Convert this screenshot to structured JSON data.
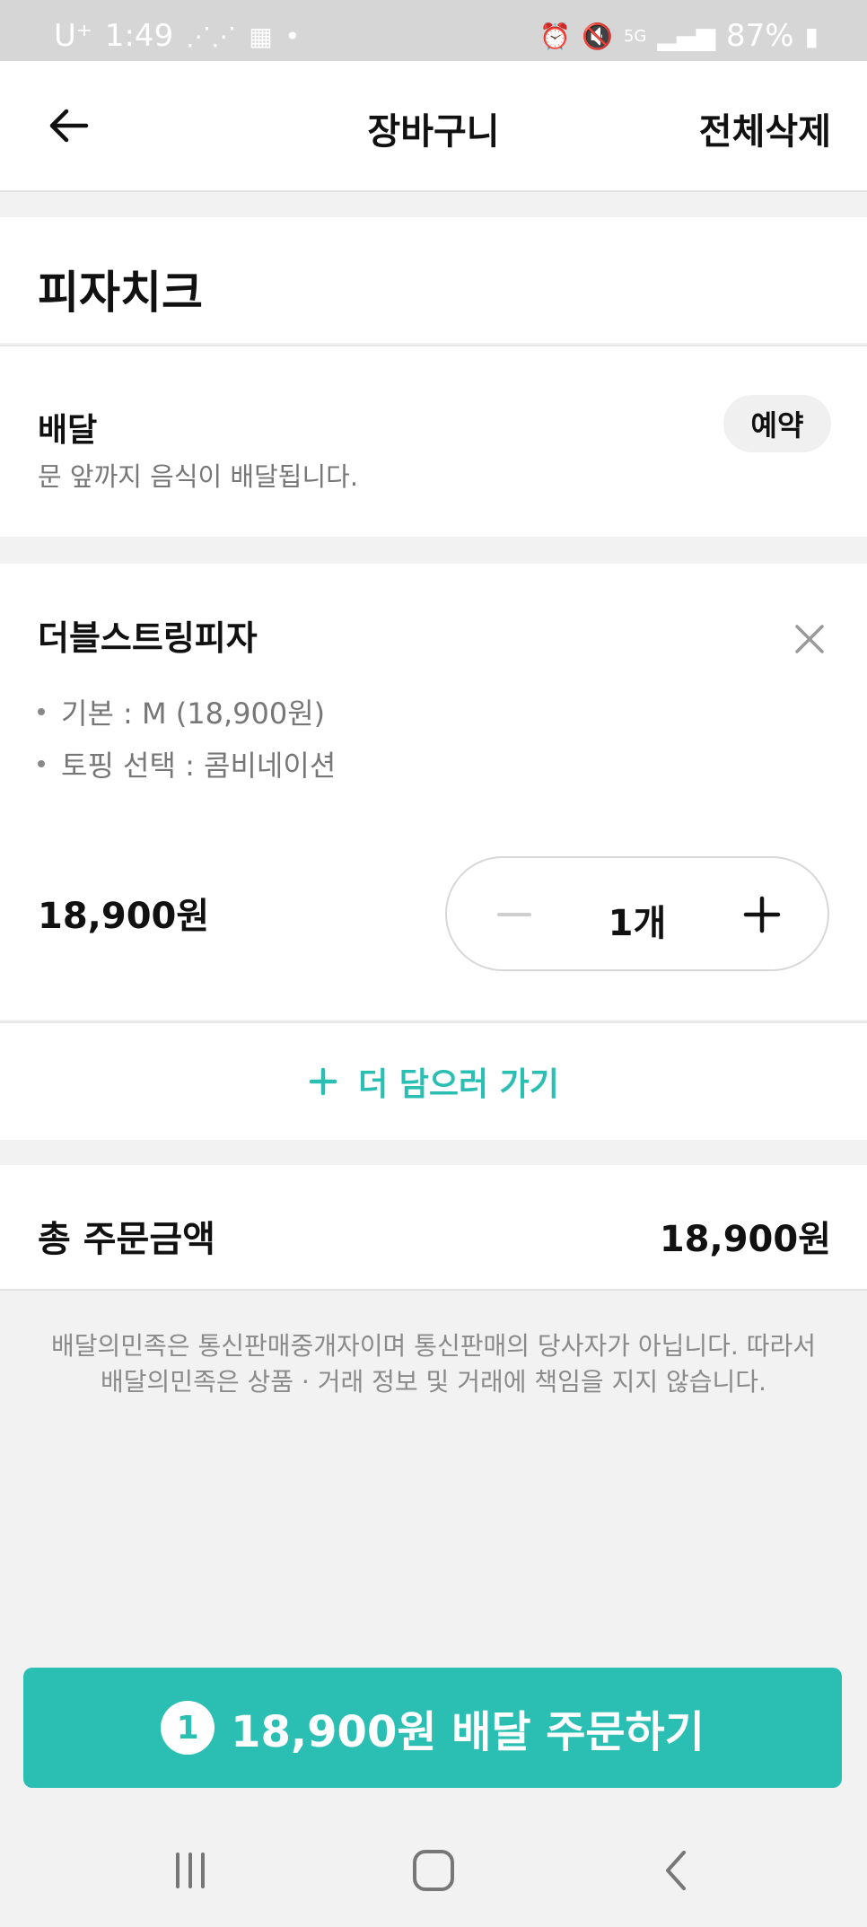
{
  "status_bar": {
    "carrier": "U⁺",
    "time": "1:49",
    "battery": "87%",
    "signal_label": "5G"
  },
  "header": {
    "title": "장바구니",
    "delete_all": "전체삭제"
  },
  "store": {
    "name": "피자치크"
  },
  "delivery": {
    "title": "배달",
    "description": "문 앞까지 음식이 배달됩니다.",
    "reserve_label": "예약"
  },
  "cart_item": {
    "name": "더블스트링피자",
    "options": [
      "기본 : M (18,900원)",
      "토핑 선택 : 콤비네이션"
    ],
    "price": "18,900원",
    "quantity": "1개"
  },
  "add_more": {
    "label": "더 담으러 가기"
  },
  "summary": {
    "total_label": "총 주문금액",
    "total_value": "18,900원"
  },
  "disclaimer": {
    "line1": "배달의민족은 통신판매중개자이며 통신판매의 당사자가 아닙니다. 따라서",
    "line2": "배달의민족은 상품 · 거래 정보 및 거래에 책임을 지지 않습니다."
  },
  "order_button": {
    "count": "1",
    "label": "18,900원 배달 주문하기"
  },
  "colors": {
    "accent": "#2bbfb4",
    "text": "#111111",
    "muted": "#777777",
    "background": "#f2f2f2"
  }
}
